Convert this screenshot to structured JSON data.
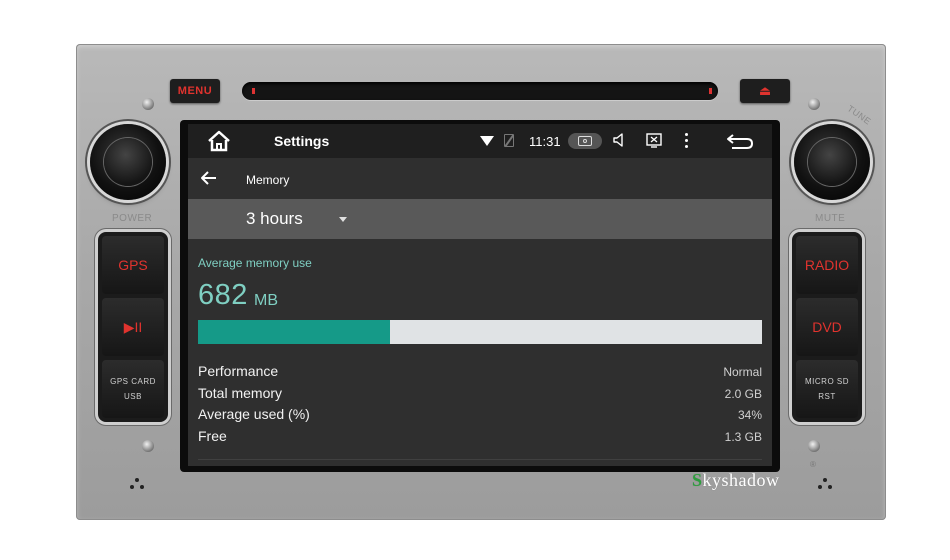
{
  "unit": {
    "menu_label": "MENU",
    "left_knob_label": "POWER",
    "right_knob_label": "MUTE",
    "tune_label": "TUNE",
    "gps_label": "GPS",
    "play_label": "▶II",
    "gps_card_label": "GPS CARD",
    "usb_label": "USB",
    "radio_label": "RADIO",
    "dvd_label": "DVD",
    "microsd_label": "MICRO SD",
    "rst_label": "RST",
    "brand_first": "S",
    "brand_rest": "kyshadow",
    "reg_mark": "®",
    "accent_color": "#e0332e"
  },
  "statusbar": {
    "title": "Settings",
    "time": "11:31",
    "icons": [
      "home-icon",
      "wifi-icon",
      "no-sim-icon",
      "screenshot-icon",
      "volume-icon",
      "screen-icon",
      "more-icon",
      "back-icon"
    ]
  },
  "toolbar": {
    "title": "Memory"
  },
  "spinner": {
    "value": "3 hours"
  },
  "memory": {
    "section_label": "Average memory use",
    "value": "682",
    "unit": "MB",
    "usage_fraction": 0.34,
    "accent_color": "#159a88"
  },
  "stats": [
    {
      "label": "Performance",
      "value": "Normal"
    },
    {
      "label": "Total memory",
      "value": "2.0 GB"
    },
    {
      "label": "Average used (%)",
      "value": "34%"
    },
    {
      "label": "Free",
      "value": "1.3 GB"
    }
  ]
}
